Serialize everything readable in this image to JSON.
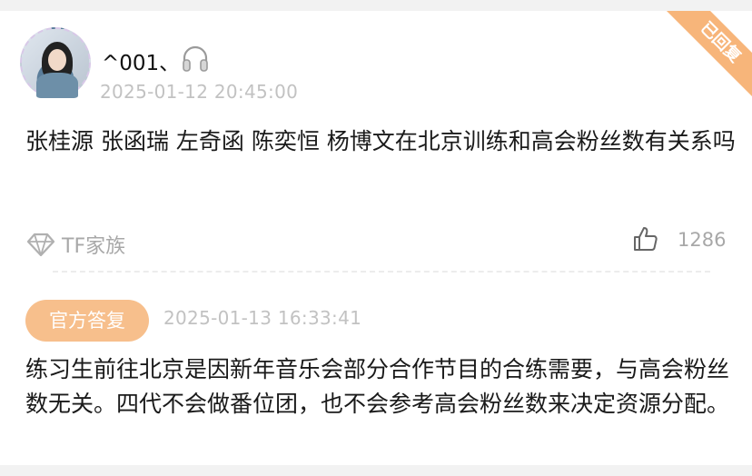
{
  "post": {
    "username": "^001、",
    "username_badge_icon": "headphones-icon",
    "time": "2025-01-12 20:45:00",
    "status_ribbon": "已回复",
    "question": "张桂源 张函瑞 左奇函 陈奕恒 杨博文在北京训练和高会粉丝数有关系吗",
    "tag": {
      "icon": "diamond-tag-icon",
      "label": "TF家族"
    },
    "likes": {
      "icon": "thumbs-up-icon",
      "count": "1286"
    }
  },
  "reply": {
    "badge": "官方答复",
    "time": "2025-01-13 16:33:41",
    "text": "练习生前往北京是因新年音乐会部分合作节目的合练需要，与高会粉丝数无关。四代不会做番位团，也不会参考高会粉丝数来决定资源分配。"
  },
  "colors": {
    "accent": "#f7b57a",
    "badge_bg": "#f7bf8c",
    "muted_text": "#c2c2c2",
    "body_text": "#1a1a1a"
  }
}
